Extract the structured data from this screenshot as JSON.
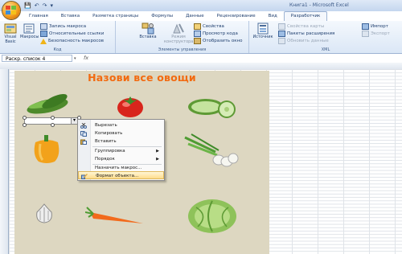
{
  "window": {
    "title": "Книга1 - Microsoft Excel"
  },
  "qat": {
    "save": "💾",
    "undo": "↶",
    "redo": "↷",
    "more": "▾"
  },
  "tabs": [
    "Главная",
    "Вставка",
    "Разметка страницы",
    "Формулы",
    "Данные",
    "Рецензирование",
    "Вид",
    "Разработчик"
  ],
  "active_tab": "Разработчик",
  "ribbon": {
    "code": {
      "label": "Код",
      "visual_basic": "Visual Basic",
      "macros": "Макросы",
      "record_macro": "Запись макроса",
      "relative_refs": "Относительные ссылки",
      "macro_security": "Безопасность макросов"
    },
    "controls": {
      "label": "Элементы управления",
      "insert": "Вставка",
      "design_mode": "Режим конструктора",
      "properties": "Свойства",
      "view_code": "Просмотр кода",
      "show_window": "Отобразить окно"
    },
    "xml": {
      "label": "XML",
      "source": "Источник",
      "map_properties": "Свойства карты",
      "expansion_packs": "Пакеты расширения",
      "refresh_data": "Обновить данные",
      "import": "Импорт",
      "export": "Экспорт"
    }
  },
  "formula_bar": {
    "name_box": "Раскр. список 4",
    "fx": "fx"
  },
  "sheet": {
    "heading": "Назови все овощи"
  },
  "context_menu": {
    "items": [
      {
        "label": "Вырезать",
        "icon": "scissors-icon"
      },
      {
        "label": "Копировать",
        "icon": "copy-icon"
      },
      {
        "label": "Вставить",
        "icon": "paste-icon"
      },
      {
        "label": "Группировка",
        "submenu": "▶"
      },
      {
        "label": "Порядок",
        "submenu": "▶"
      },
      {
        "label": "Назначить макрос..."
      },
      {
        "label": "Формат объекта...",
        "icon": "format-object-icon",
        "highlighted": true
      }
    ]
  },
  "colors": {
    "accent": "#f26a10",
    "panel": "#ddd7c1",
    "ribbon_text": "#1f3f6f"
  }
}
